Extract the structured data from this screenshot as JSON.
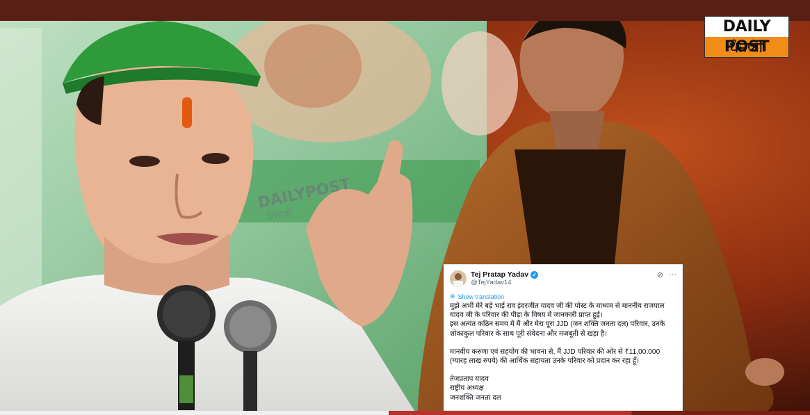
{
  "image": {
    "description_icons": [
      "politician-photo",
      "actor-photo"
    ]
  },
  "logo": {
    "line1": "DAILY POST",
    "line2": "ਪੰਜਾਬੀ"
  },
  "watermark": {
    "line1": "DAILYPOST",
    "line2": "ਪੰਜਾਬੀ"
  },
  "tweet": {
    "name": "Tej Pratap Yadav",
    "handle": "@TejYadav14",
    "translate": "Show translation",
    "paragraph1": "मुझे अभी मेरे बड़े भाई राव इंदरजीत यादव जी की पोस्ट के माध्यम से माननीय राजपाल यादव जी के परिवार की पीड़ा के विषय में जानकारी प्राप्त हुई।\nइस अत्यंत कठिन समय में मैं और मेरा पूरा JJD (जन शक्ति जनता दल) परिवार, उनके शोकाकुल परिवार के साथ पूरी संवेदना और मजबूती से खड़ा है।",
    "paragraph2": "मानवीय करुणा एवं सहयोग की भावना से, मैं JJD परिवार की ओर से ₹11,00,000 (ग्यारह लाख रुपये) की आर्थिक सहायता उनके परिवार को प्रदान कर रहा हूँ।",
    "paragraph3": "तेजप्रताप यादव\nराष्ट्रीय अध्यक्ष\nजनशक्ति जनता दल"
  },
  "colors": {
    "verified": "#1d9bf0",
    "logo_orange": "#f28c18"
  }
}
